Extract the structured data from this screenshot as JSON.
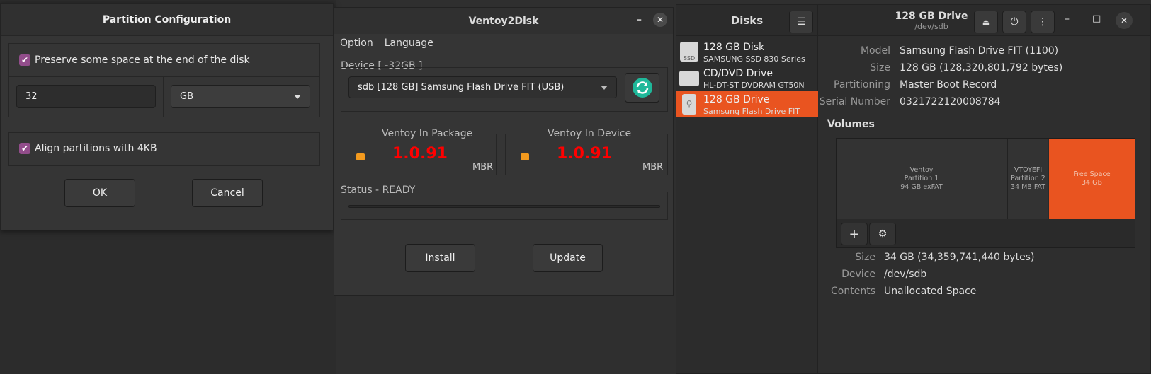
{
  "partition_dialog": {
    "title": "Partition Configuration",
    "preserve_label": "Preserve some space at the end of the disk",
    "size_value": "32",
    "unit_value": "GB",
    "align_label": "Align partitions with 4KB",
    "ok_label": "OK",
    "cancel_label": "Cancel"
  },
  "ventoy": {
    "title": "Ventoy2Disk",
    "menu": [
      "Option",
      "Language"
    ],
    "device_label": "Device  [ -32GB ]",
    "device_value": "sdb  [128 GB]  Samsung Flash Drive FIT (USB)",
    "package_label": "Ventoy In Package",
    "package_version": "1.0.91",
    "package_style": "MBR",
    "device_label2": "Ventoy In Device",
    "device_version": "1.0.91",
    "device_style": "MBR",
    "status_label": "Status - READY",
    "install_label": "Install",
    "update_label": "Update",
    "version_color": "#ff0000"
  },
  "disks": {
    "sidebar_title": "Disks",
    "header_title": "128 GB Drive",
    "header_sub": "/dev/sdb",
    "items": [
      {
        "title": "128 GB Disk",
        "sub": "SAMSUNG SSD 830 Series",
        "icon": "ssd-icon",
        "icon_text": "SSD"
      },
      {
        "title": "CD/DVD Drive",
        "sub": "HL-DT-ST DVDRAM GT50N",
        "icon": "optical-drive-icon"
      },
      {
        "title": "128 GB Drive",
        "sub": "Samsung Flash Drive FIT",
        "icon": "usb-drive-icon"
      }
    ],
    "props": [
      {
        "label": "Model",
        "value": "Samsung Flash Drive FIT (1100)"
      },
      {
        "label": "Size",
        "value": "128 GB (128,320,801,792 bytes)"
      },
      {
        "label": "Partitioning",
        "value": "Master Boot Record"
      },
      {
        "label": "Serial Number",
        "value": "0321722120008784"
      }
    ],
    "volumes_title": "Volumes",
    "volumes": [
      {
        "name": "Ventoy",
        "part": "Partition 1",
        "info": "94 GB exFAT"
      },
      {
        "name": "VTOYEFI",
        "part": "Partition 2",
        "info": "34 MB FAT"
      },
      {
        "name": "Free Space",
        "part": "",
        "info": "34 GB"
      }
    ],
    "vol_props": [
      {
        "label": "Size",
        "value": "34 GB (34,359,741,440 bytes)"
      },
      {
        "label": "Device",
        "value": "/dev/sdb"
      },
      {
        "label": "Contents",
        "value": "Unallocated Space"
      }
    ],
    "accent_color": "#e95420"
  }
}
